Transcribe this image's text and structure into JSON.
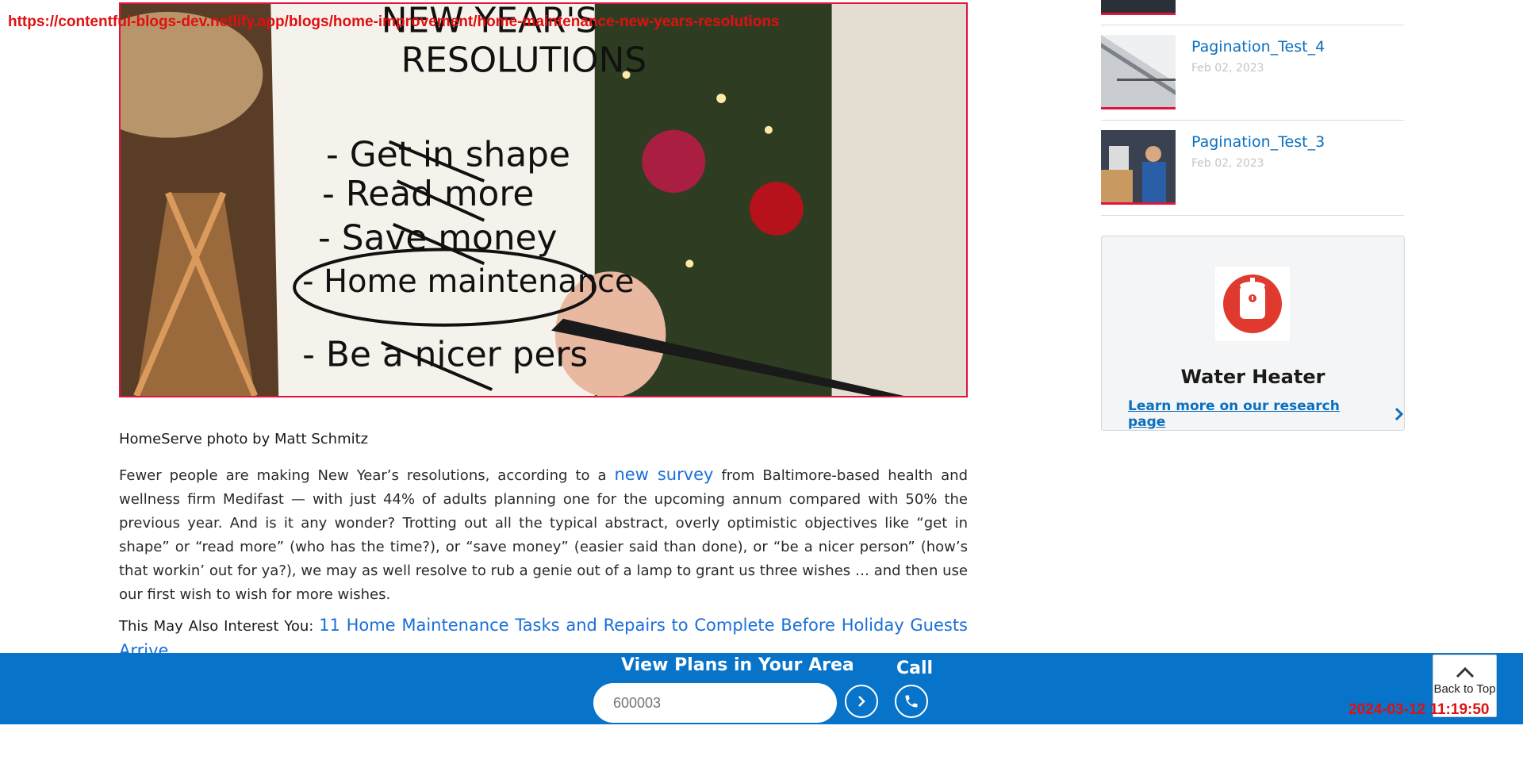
{
  "overlay": {
    "url": "https://contentful-blogs-dev.netlify.app/blogs/home-improvement/home-maintenance-new-years-resolutions",
    "timestamp": "2024-03-12 11:19:50"
  },
  "hero": {
    "note_lines": [
      "NEW YEAR'S",
      "RESOLUTIONS",
      "- Get in shape",
      "- Read more",
      "- Save money",
      "- Home maintenance",
      "- Be a nicer pers"
    ]
  },
  "article": {
    "caption": "HomeServe photo by Matt Schmitz",
    "para_before": "Fewer people are making New Year’s resolutions, according to a ",
    "para_link": "new survey",
    "para_after": " from Baltimore-based health and wellness firm Medifast — with just 44% of adults planning one for the upcoming annum compared with 50% the previous year. And is it any wonder? Trotting out all the typical abstract, overly optimistic objectives like “get in shape” or “read more” (who has the time?), or “save money” (easier said than done), or “be a nicer person” (how’s that workin’ out for ya?), we may as well resolve to rub a genie out of a lamp to grant us three wishes … and then use our first wish to wish for more wishes.",
    "interest_label": "This May Also Interest You: ",
    "interest_link": "11 Home Maintenance Tasks and Repairs to Complete Before Holiday Guests Arrive"
  },
  "sidebar": {
    "items": [
      {
        "title": "Pagination_Test_4",
        "date": "Feb 02, 2023"
      },
      {
        "title": "Pagination_Test_3",
        "date": "Feb 02, 2023"
      }
    ],
    "card": {
      "icon": "water-heater-icon",
      "title": "Water Heater",
      "link": "Learn more on our research page"
    }
  },
  "bottom_bar": {
    "plans_label": "View Plans in Your Area",
    "zip_placeholder": "600003",
    "call_label": "Call",
    "back_to_top": "Back to Top"
  },
  "colors": {
    "brand_blue": "#0773c9",
    "link_blue": "#1a6fd8",
    "accent_red": "#e0143c",
    "overlay_red": "#e01010"
  }
}
